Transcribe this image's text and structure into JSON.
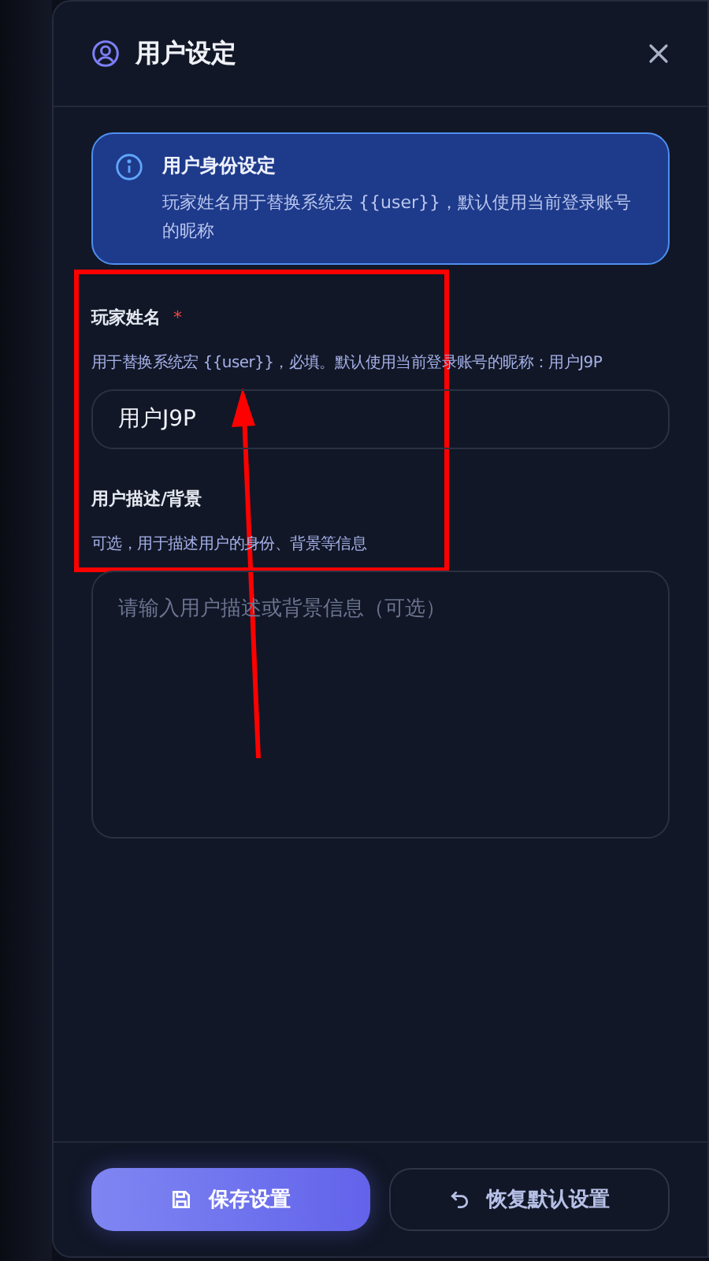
{
  "dialog": {
    "title": "用户设定"
  },
  "info": {
    "title": "用户身份设定",
    "text": "玩家姓名用于替换系统宏 {{user}}，默认使用当前登录账号的昵称"
  },
  "fields": [
    {
      "kind": "input",
      "label": "玩家姓名",
      "required": true,
      "required_mark": "*",
      "hint": "用于替换系统宏 {{user}}，必填。默认使用当前登录账号的昵称：用户J9P",
      "value": "用户J9P"
    },
    {
      "kind": "textarea",
      "label": "用户描述/背景",
      "required": false,
      "hint": "可选，用于描述用户的身份、背景等信息",
      "placeholder": "请输入用户描述或背景信息（可选）"
    }
  ],
  "buttons": [
    {
      "kind": "primary",
      "label": "保存设置"
    },
    {
      "kind": "secondary",
      "label": "恢复默认设置"
    }
  ]
}
